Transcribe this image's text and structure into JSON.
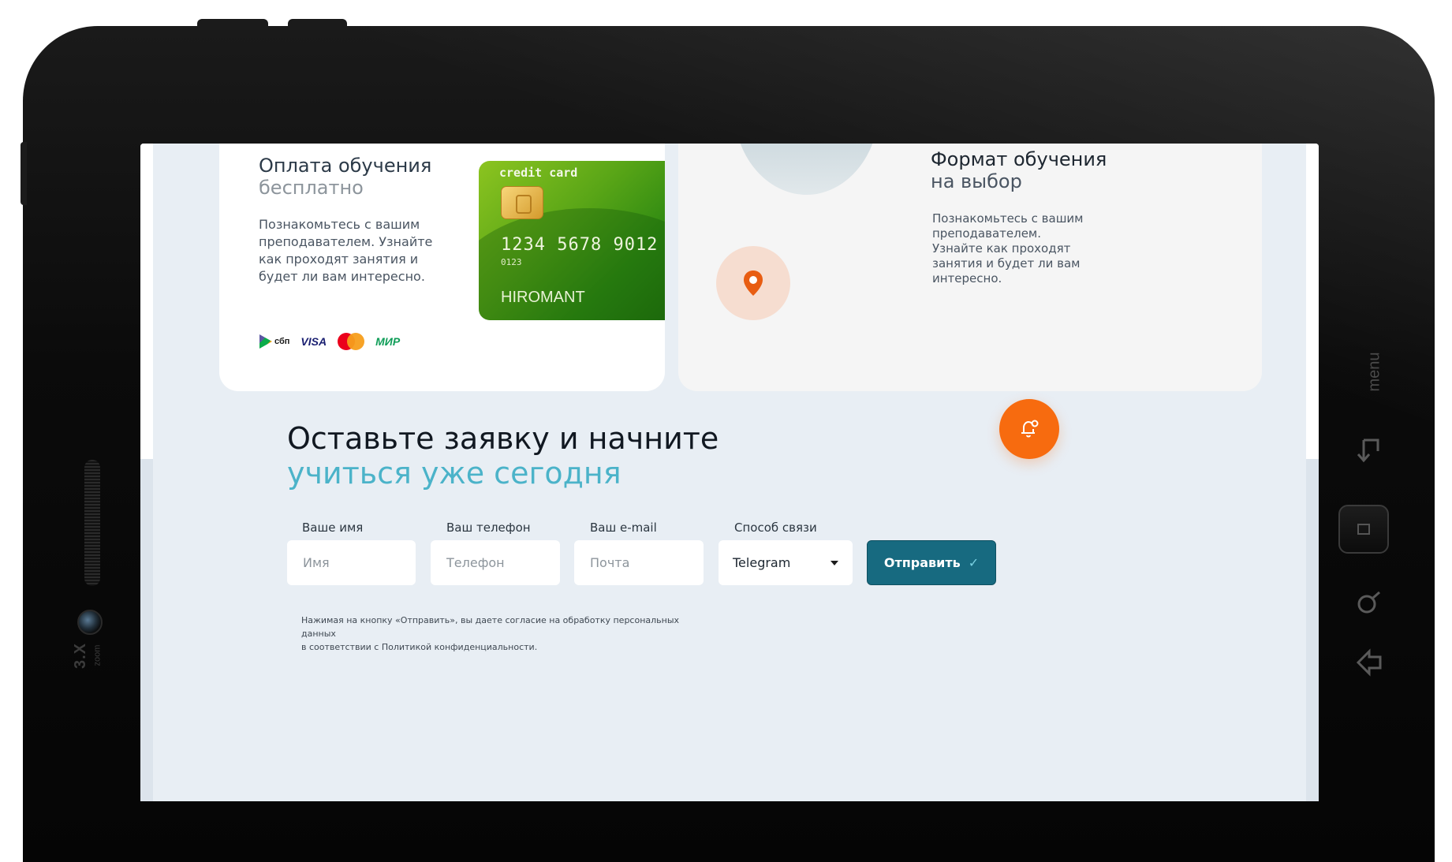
{
  "device": {
    "zoom_label": "3.X",
    "zoom_sub": "zoom",
    "menu_label": "menu"
  },
  "card_payment": {
    "title": "Оплата обучения",
    "subtitle": "бесплатно",
    "description": "Познакомьтесь с вашим преподавателем. Узнайте как проходят занятия и будет ли вам интересно.",
    "logos": {
      "sbp": "сбп",
      "visa": "VISA",
      "mastercard": "mastercard",
      "mir": "МИР"
    },
    "credit_card": {
      "type_label": "credit card",
      "number": "1234  5678  9012",
      "small_number": "0123",
      "holder": "HIROMANT"
    }
  },
  "card_format": {
    "title": "Формат обучения",
    "subtitle": "на выбор",
    "description": "Познакомьтесь с вашим преподавателем. Узнайте как проходят занятия и будет ли вам интересно."
  },
  "form": {
    "heading_line1": "Оставьте заявку и начните",
    "heading_line2": "учиться уже сегодня",
    "name_label": "Ваше имя",
    "name_placeholder": "Имя",
    "phone_label": "Ваш телефон",
    "phone_placeholder": "Телефон",
    "email_label": "Ваш e-mail",
    "email_placeholder": "Почта",
    "contact_label": "Способ связи",
    "contact_value": "Telegram",
    "submit_label": "Отправить",
    "consent_line1": "Нажимая на кнопку «Отправить», вы даете согласие на обработку персональных данных",
    "consent_line2": "в соответствии с Политикой конфиденциальности."
  },
  "colors": {
    "accent_orange": "#f76b0f",
    "accent_teal": "#4bb3c9",
    "button_teal": "#176a80",
    "section_bg": "#e8eef4"
  }
}
